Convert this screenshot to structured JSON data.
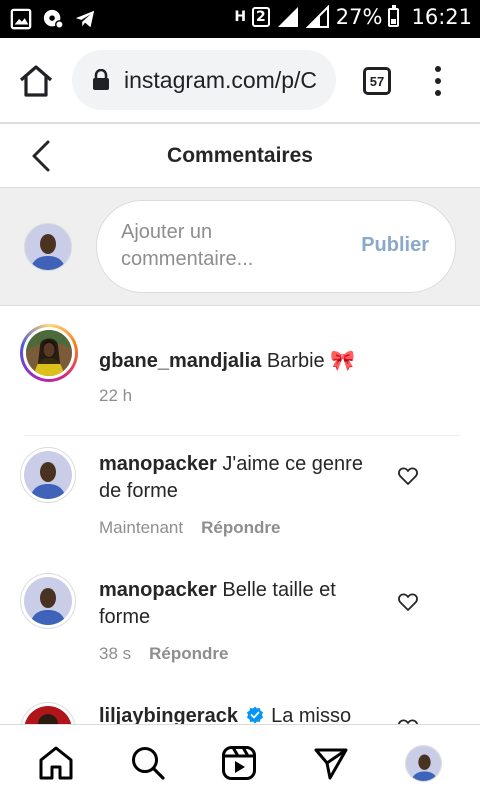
{
  "status_bar": {
    "network_type": "H",
    "sim_label": "2",
    "battery": "27%",
    "battery_level": 0.27,
    "time": "16:21"
  },
  "browser": {
    "url": "instagram.com/p/C",
    "tab_count": "57"
  },
  "header": {
    "title": "Commentaires"
  },
  "composer": {
    "placeholder": "Ajouter un commentaire...",
    "publish_label": "Publier"
  },
  "comments": [
    {
      "username": "gbane_mandjalia",
      "text": "Barbie 🎀",
      "time": "22 h",
      "reply_label": "",
      "has_story_ring": true
    },
    {
      "username": "manopacker",
      "text": "J'aime ce genre de forme",
      "time": "Maintenant",
      "reply_label": "Répondre",
      "has_story_ring": false
    },
    {
      "username": "manopacker",
      "text": "Belle taille et forme",
      "time": "38 s",
      "reply_label": "Répondre",
      "has_story_ring": false
    },
    {
      "username": "liljaybingerack",
      "text": "La misso",
      "verified": true,
      "time": "",
      "reply_label": "",
      "has_story_ring": false
    }
  ],
  "icons": {
    "status": [
      "gallery-icon",
      "location-icon",
      "telegram-icon",
      "signal-icon",
      "battery-icon"
    ],
    "browser": [
      "home-icon",
      "lock-icon",
      "tabs-icon",
      "more-vertical-icon"
    ],
    "nav": [
      "home-icon",
      "search-icon",
      "reels-icon",
      "direct-send-icon"
    ]
  },
  "colors": {
    "publish_disabled": "#8aa9c8",
    "verified_blue": "#0095f6",
    "secondary_text": "#8e8e8e"
  }
}
